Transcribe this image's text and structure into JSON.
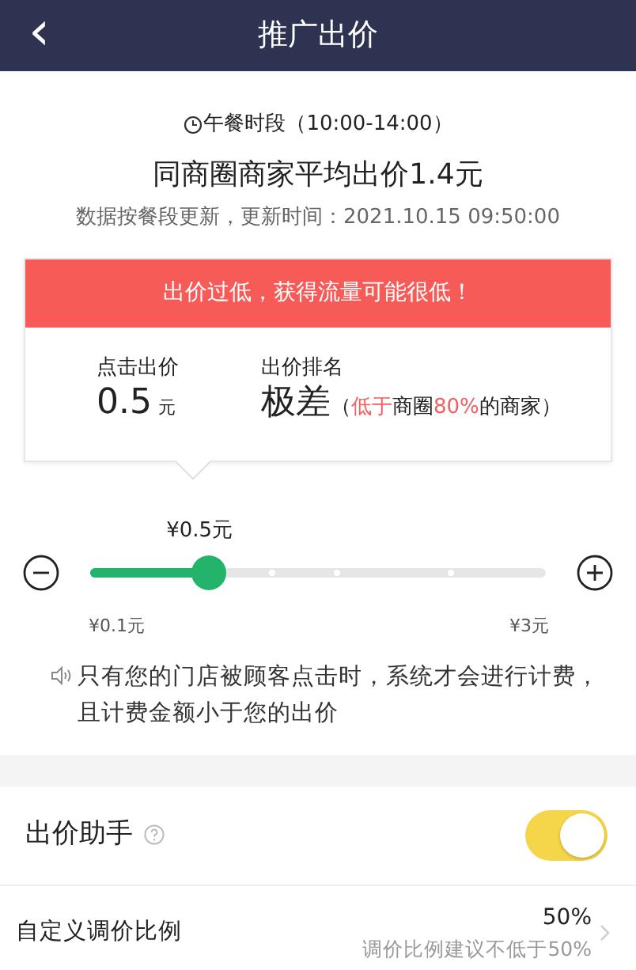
{
  "header": {
    "back": "‹",
    "title": "推广出价"
  },
  "period": "午餐时段（10:00-14:00）",
  "average": "同商圈商家平均出价1.4元",
  "update_note": "数据按餐段更新，更新时间：2021.10.15 09:50:00",
  "warning": "出价过低，获得流量可能很低！",
  "bid": {
    "label": "点击出价",
    "value": "0.5",
    "unit": "元"
  },
  "rank": {
    "label": "出价排名",
    "value": "极差",
    "note": [
      {
        "text": "（",
        "highlight": false
      },
      {
        "text": "低于",
        "highlight": true
      },
      {
        "text": "商圈",
        "highlight": false
      },
      {
        "text": "80%",
        "highlight": true
      },
      {
        "text": "的商家）",
        "highlight": false
      }
    ]
  },
  "slider": {
    "reading": "¥0.5元",
    "level": 0.24,
    "min_label": "¥0.1元",
    "max_label": "¥3元"
  },
  "billing_note": "只有您的门店被顾客点击时，系统才会进行计费，且计费金额小于您的出价",
  "assistant": {
    "label": "出价助手",
    "on": true
  },
  "ratio": {
    "label": "自定义调价比例",
    "value": "50%",
    "hint": "调价比例建议不低于50%"
  }
}
